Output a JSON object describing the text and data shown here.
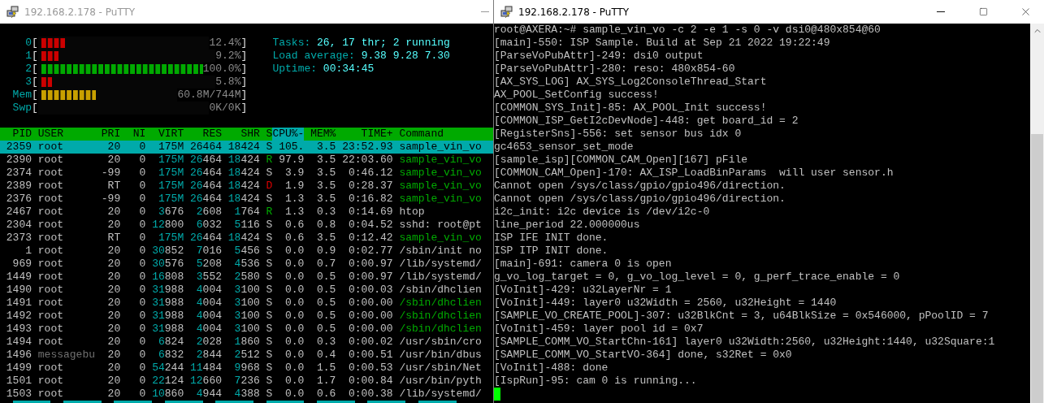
{
  "left_window": {
    "title": "192.168.2.178 - PuTTY",
    "active": false,
    "meters": [
      {
        "label": "0",
        "open": "[",
        "close": "]",
        "level": 0.124,
        "reading": "12.4%",
        "color": "#cc0000"
      },
      {
        "label": "1",
        "open": "[",
        "close": "]",
        "level": 0.092,
        "reading": "9.2%",
        "color": "#cc0000"
      },
      {
        "label": "2",
        "open": "[",
        "close": "]",
        "level": 1,
        "reading": "100.0%",
        "color": "#00aa00"
      },
      {
        "label": "3",
        "open": "[",
        "close": "]",
        "level": 0.058,
        "reading": "5.8%",
        "color": "#cc0000"
      },
      {
        "label": "Mem",
        "open": "[",
        "close": "]",
        "level": 0.28,
        "reading": "60.8M/744M",
        "color": "#c8a000"
      },
      {
        "label": "Swp",
        "open": "[",
        "close": "]",
        "reading": "0K/0K"
      }
    ],
    "summary": [
      {
        "label": "Tasks:",
        "value": "26, 17 thr; 2 running"
      },
      {
        "label": "Load average:",
        "value": "9.38 9.28 7.30"
      },
      {
        "label": "Uptime:",
        "value": "00:34:45"
      }
    ],
    "table": {
      "columns": [
        {
          "label": "PID",
          "sorted": false
        },
        {
          "label": "USER",
          "sorted": false
        },
        {
          "label": "PRI",
          "sorted": false
        },
        {
          "label": "NI",
          "sorted": false
        },
        {
          "label": "VIRT",
          "sorted": false
        },
        {
          "label": "RES",
          "sorted": false
        },
        {
          "label": "SHR",
          "sorted": false
        },
        {
          "label": "S",
          "sorted": false
        },
        {
          "label": "CPU%-",
          "sorted": true
        },
        {
          "label": "MEM%",
          "sorted": false
        },
        {
          "label": "TIME+",
          "sorted": false
        },
        {
          "label": "Command",
          "sorted": false
        }
      ],
      "rows": [
        {
          "pid": "2359",
          "user": "root",
          "pri": "20",
          "ni": "0",
          "virt": "175M",
          "res": "26464",
          "shr": "18424",
          "state": "S",
          "cpu": "105.",
          "mem": "3.5",
          "time": "23:52.93",
          "command": "sample_vin_vo",
          "selected": true
        },
        {
          "pid": "2390",
          "user": "root",
          "pri": "20",
          "ni": "0",
          "virt": "175M",
          "res": "26464",
          "shr": "18424",
          "state": "R",
          "color": "#00aa00",
          "cpu": "97.9",
          "mem": "3.5",
          "time": "22:03.60",
          "command": "sample_vin_vo",
          "thread": true,
          "dim_user": false,
          "selected": false
        },
        {
          "pid": "2374",
          "user": "root",
          "pri": "-99",
          "ni": "0",
          "virt": "175M",
          "res": "26464",
          "shr": "18424",
          "state": "S",
          "color": "#c0c0c0",
          "cpu": "3.9",
          "mem": "3.5",
          "time": "0:46.12",
          "command": "sample_vin_vo",
          "thread": true,
          "dim_user": false,
          "selected": false
        },
        {
          "pid": "2389",
          "user": "root",
          "pri": "RT",
          "ni": "0",
          "virt": "175M",
          "res": "26464",
          "shr": "18424",
          "state": "D",
          "color": "#dd0000",
          "cpu": "1.9",
          "mem": "3.5",
          "time": "0:28.37",
          "command": "sample_vin_vo",
          "thread": true,
          "dim_user": false,
          "selected": false
        },
        {
          "pid": "2376",
          "user": "root",
          "pri": "-99",
          "ni": "0",
          "virt": "175M",
          "res": "26464",
          "shr": "18424",
          "state": "S",
          "color": "#c0c0c0",
          "cpu": "1.3",
          "mem": "3.5",
          "time": "0:16.82",
          "command": "sample_vin_vo",
          "thread": true,
          "dim_user": false,
          "selected": false
        },
        {
          "pid": "2467",
          "user": "root",
          "pri": "20",
          "ni": "0",
          "virt": "3676",
          "res": "2608",
          "shr": "1764",
          "state": "R",
          "color": "#00aa00",
          "cpu": "1.3",
          "mem": "0.3",
          "time": "0:14.69",
          "command": "htop",
          "thread": false,
          "dim_user": false,
          "selected": false
        },
        {
          "pid": "2304",
          "user": "root",
          "pri": "20",
          "ni": "0",
          "virt": "12800",
          "res": "6032",
          "shr": "5116",
          "state": "S",
          "color": "#c0c0c0",
          "cpu": "0.6",
          "mem": "0.8",
          "time": "0:04.52",
          "command": "sshd: root@pt",
          "thread": false,
          "dim_user": false,
          "selected": false
        },
        {
          "pid": "2373",
          "user": "root",
          "pri": "RT",
          "ni": "0",
          "virt": "175M",
          "res": "26464",
          "shr": "18424",
          "state": "S",
          "color": "#c0c0c0",
          "cpu": "0.6",
          "mem": "3.5",
          "time": "0:12.42",
          "command": "sample_vin_vo",
          "thread": true,
          "dim_user": false,
          "selected": false
        },
        {
          "pid": "1",
          "user": "root",
          "pri": "20",
          "ni": "0",
          "virt": "30852",
          "res": "7016",
          "shr": "5456",
          "state": "S",
          "color": "#c0c0c0",
          "cpu": "0.0",
          "mem": "0.9",
          "time": "0:02.77",
          "command": "/sbin/init no",
          "thread": false,
          "dim_user": false,
          "selected": false
        },
        {
          "pid": "969",
          "user": "root",
          "pri": "20",
          "ni": "0",
          "virt": "30576",
          "res": "5208",
          "shr": "4536",
          "state": "S",
          "color": "#c0c0c0",
          "cpu": "0.0",
          "mem": "0.7",
          "time": "0:00.97",
          "command": "/lib/systemd/",
          "thread": false,
          "dim_user": false,
          "selected": false
        },
        {
          "pid": "1449",
          "user": "root",
          "pri": "20",
          "ni": "0",
          "virt": "16808",
          "res": "3552",
          "shr": "2580",
          "state": "S",
          "color": "#c0c0c0",
          "cpu": "0.0",
          "mem": "0.5",
          "time": "0:00.97",
          "command": "/lib/systemd/",
          "thread": false,
          "dim_user": false,
          "selected": false
        },
        {
          "pid": "1490",
          "user": "root",
          "pri": "20",
          "ni": "0",
          "virt": "31988",
          "res": "4004",
          "shr": "3100",
          "state": "S",
          "color": "#c0c0c0",
          "cpu": "0.0",
          "mem": "0.5",
          "time": "0:00.03",
          "command": "/sbin/dhclien",
          "thread": false,
          "dim_user": false,
          "selected": false
        },
        {
          "pid": "1491",
          "user": "root",
          "pri": "20",
          "ni": "0",
          "virt": "31988",
          "res": "4004",
          "shr": "3100",
          "state": "S",
          "color": "#c0c0c0",
          "cpu": "0.0",
          "mem": "0.5",
          "time": "0:00.00",
          "command": "/sbin/dhclien",
          "thread": true,
          "dim_user": false,
          "selected": false
        },
        {
          "pid": "1492",
          "user": "root",
          "pri": "20",
          "ni": "0",
          "virt": "31988",
          "res": "4004",
          "shr": "3100",
          "state": "S",
          "color": "#c0c0c0",
          "cpu": "0.0",
          "mem": "0.5",
          "time": "0:00.00",
          "command": "/sbin/dhclien",
          "thread": true,
          "dim_user": false,
          "selected": false
        },
        {
          "pid": "1493",
          "user": "root",
          "pri": "20",
          "ni": "0",
          "virt": "31988",
          "res": "4004",
          "shr": "3100",
          "state": "S",
          "color": "#c0c0c0",
          "cpu": "0.0",
          "mem": "0.5",
          "time": "0:00.00",
          "command": "/sbin/dhclien",
          "thread": true,
          "dim_user": false,
          "selected": false
        },
        {
          "pid": "1494",
          "user": "root",
          "pri": "20",
          "ni": "0",
          "virt": "6824",
          "res": "2028",
          "shr": "1860",
          "state": "S",
          "color": "#c0c0c0",
          "cpu": "0.0",
          "mem": "0.3",
          "time": "0:00.02",
          "command": "/usr/sbin/cro",
          "thread": false,
          "dim_user": false,
          "selected": false
        },
        {
          "pid": "1496",
          "user": "messagebu",
          "pri": "20",
          "ni": "0",
          "virt": "6832",
          "res": "2844",
          "shr": "2512",
          "state": "S",
          "color": "#c0c0c0",
          "cpu": "0.0",
          "mem": "0.4",
          "time": "0:00.51",
          "command": "/usr/bin/dbus",
          "thread": false,
          "dim_user": true,
          "selected": false
        },
        {
          "pid": "1499",
          "user": "root",
          "pri": "20",
          "ni": "0",
          "virt": "54244",
          "res": "11484",
          "shr": "9968",
          "state": "S",
          "color": "#c0c0c0",
          "cpu": "0.0",
          "mem": "1.5",
          "time": "0:00.53",
          "command": "/usr/sbin/Net",
          "thread": false,
          "dim_user": false,
          "selected": false
        },
        {
          "pid": "1501",
          "user": "root",
          "pri": "20",
          "ni": "0",
          "virt": "22124",
          "res": "12660",
          "shr": "7236",
          "state": "S",
          "color": "#c0c0c0",
          "cpu": "0.0",
          "mem": "1.7",
          "time": "0:00.84",
          "command": "/usr/bin/pyth",
          "thread": false,
          "dim_user": false,
          "selected": false
        },
        {
          "pid": "1503",
          "user": "root",
          "pri": "20",
          "ni": "0",
          "virt": "10860",
          "res": "4944",
          "shr": "4388",
          "state": "S",
          "color": "#c0c0c0",
          "cpu": "0.0",
          "mem": "0.6",
          "time": "0:00.38",
          "command": "/lib/systemd/",
          "thread": false,
          "dim_user": false,
          "selected": false
        }
      ]
    }
  },
  "right_window": {
    "title": "192.168.2.178 - PuTTY",
    "active": true,
    "lines": [
      "root@AXERA:~# sample_vin_vo -c 2 -e 1 -s 0 -v dsi0@480x854@60",
      "[main]-550: ISP Sample. Build at Sep 21 2022 19:22:49",
      "[ParseVoPubAttr]-249: dsi0 output",
      "[ParseVoPubAttr]-280: reso: 480x854-60",
      "[AX_SYS_LOG] AX_SYS_Log2ConsoleThread_Start",
      "AX_POOL_SetConfig success!",
      "[COMMON_SYS_Init]-85: AX_POOL_Init success!",
      "[COMMON_ISP_GetI2cDevNode]-448: get board_id = 2",
      "[RegisterSns]-556: set sensor bus idx 0",
      "gc4653_sensor_set_mode",
      "[sample_isp][COMMON_CAM_Open][167] pFile",
      "[COMMON_CAM_Open]-170: AX_ISP_LoadBinParams  will user sensor.h",
      "Cannot open /sys/class/gpio/gpio496/direction.",
      "Cannot open /sys/class/gpio/gpio496/direction.",
      "i2c_init: i2c device is /dev/i2c-0",
      "line_period 22.000000us",
      "ISP IFE INIT done.",
      "ISP ITP INIT done.",
      "[main]-691: camera 0 is open",
      "g_vo_log_target = 0, g_vo_log_level = 0, g_perf_trace_enable = 0",
      "[VoInit]-429: u32LayerNr = 1",
      "[VoInit]-449: layer0 u32Width = 2560, u32Height = 1440",
      "[SAMPLE_VO_CREATE_POOL]-307: u32BlkCnt = 3, u64BlkSize = 0x546000, pPoolID = 7",
      "[VoInit]-459: layer pool id = 0x7",
      "[SAMPLE_COMM_VO_StartChn-161] layer0 u32Width:2560, u32Height:1440, u32Square:1",
      "[SAMPLE_COMM_VO_StartVO-364] done, s32Ret = 0x0",
      "[VoInit]-488: done",
      "[IspRun]-95: cam 0 is running..."
    ]
  }
}
